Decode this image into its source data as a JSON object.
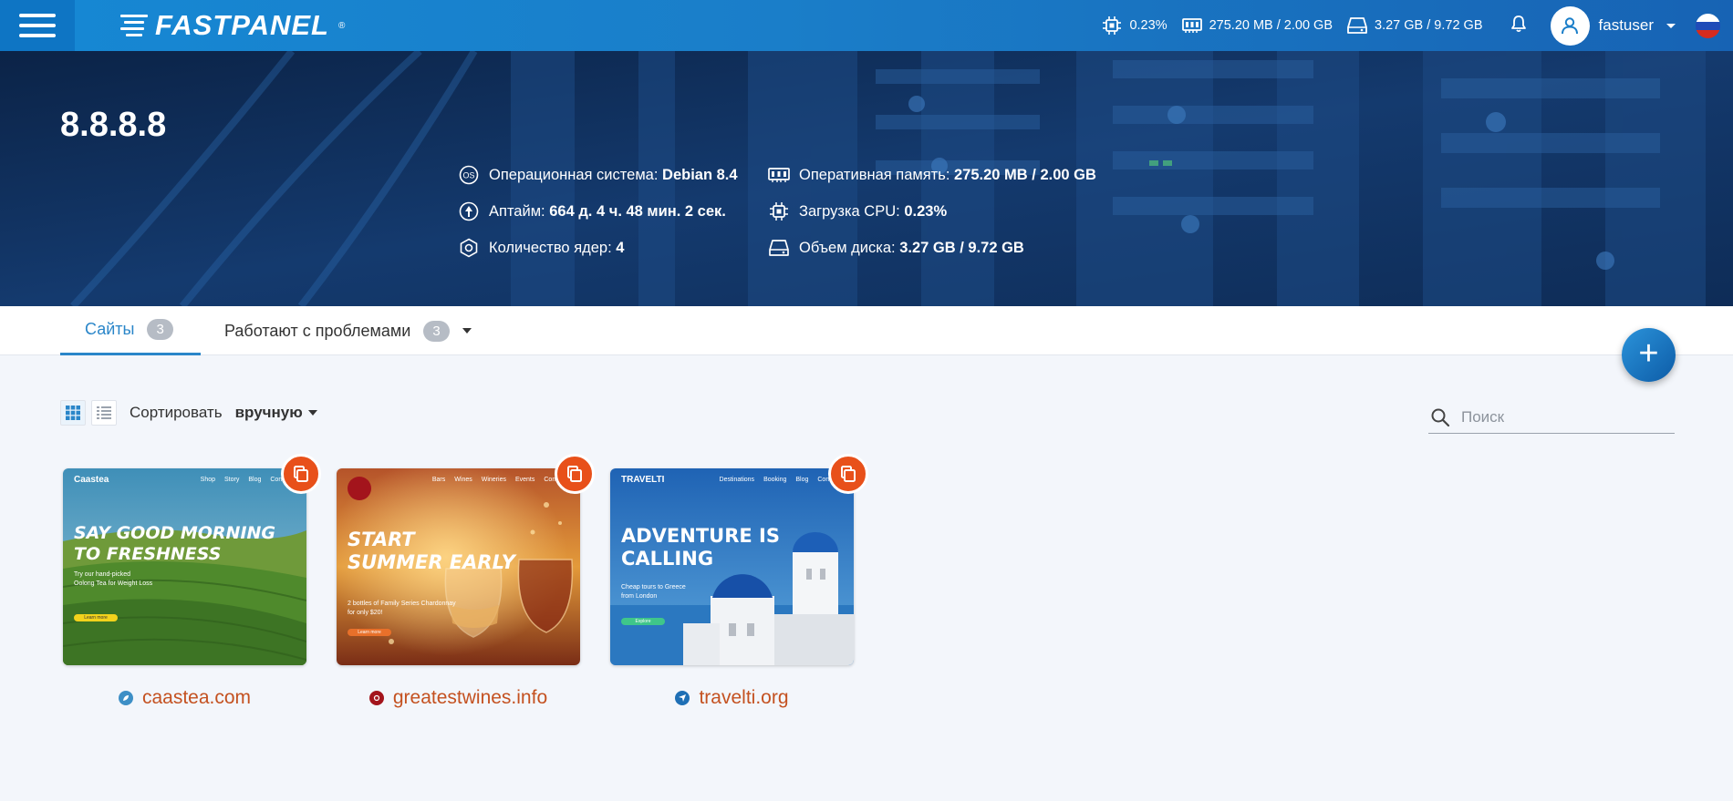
{
  "app": {
    "title": "FASTPANEL"
  },
  "topbar": {
    "cpu": "0.23%",
    "ram": "275.20 MB / 2.00 GB",
    "disk": "3.27 GB / 9.72 GB",
    "user": "fastuser"
  },
  "server": {
    "ip": "8.8.8.8",
    "info_left": [
      {
        "icon": "os-icon",
        "label": "Операционная система: ",
        "value": "Debian 8.4"
      },
      {
        "icon": "uptime-icon",
        "label": "Аптайм: ",
        "value": "664 д. 4 ч. 48 мин. 2 сек."
      },
      {
        "icon": "cores-icon",
        "label": "Количество ядер: ",
        "value": "4"
      }
    ],
    "info_right": [
      {
        "icon": "ram-icon",
        "label": "Оперативная память: ",
        "value": "275.20 MB / 2.00 GB"
      },
      {
        "icon": "cpu-icon",
        "label": "Загрузка CPU: ",
        "value": "0.23%"
      },
      {
        "icon": "disk-icon",
        "label": "Объем диска: ",
        "value": "3.27 GB / 9.72 GB"
      }
    ]
  },
  "tabs": [
    {
      "label": "Сайты",
      "count": "3",
      "active": true
    },
    {
      "label": "Работают с проблемами",
      "count": "3",
      "active": false
    }
  ],
  "toolbar": {
    "sort_label": "Сортировать",
    "sort_value": "вручную",
    "search_placeholder": "Поиск"
  },
  "sites": [
    {
      "domain": "caastea.com",
      "thumb": {
        "brand": "Caastea",
        "nav": [
          "Shop",
          "Story",
          "Blog",
          "Contacts"
        ],
        "title_lines": [
          "Say good morning",
          "to freshness"
        ],
        "sub_lines": [
          "Try our hand-picked",
          "Oolong Tea for Weight Loss"
        ],
        "button": "Learn more"
      }
    },
    {
      "domain": "greatestwines.info",
      "thumb": {
        "brand": "",
        "nav": [
          "Bars",
          "Wines",
          "Wineries",
          "Events",
          "Contacts"
        ],
        "title_lines": [
          "Start",
          "summer early"
        ],
        "sub_lines": [
          "2 bottles of Family Series Chardonnay",
          "for only $20!"
        ],
        "button": "Learn more"
      }
    },
    {
      "domain": "travelti.org",
      "thumb": {
        "brand": "TRAVELTI",
        "nav": [
          "Destinations",
          "Booking",
          "Blog",
          "Contacts"
        ],
        "title_lines": [
          "Adventure is",
          "calling"
        ],
        "sub_lines": [
          "Cheap tours to Greece",
          "from London"
        ],
        "button": "Explore"
      }
    }
  ],
  "colors": {
    "accent": "#2a86c9",
    "topbar": "#1a7ec9",
    "site_link": "#c45120",
    "copy_button": "#e8501a"
  }
}
